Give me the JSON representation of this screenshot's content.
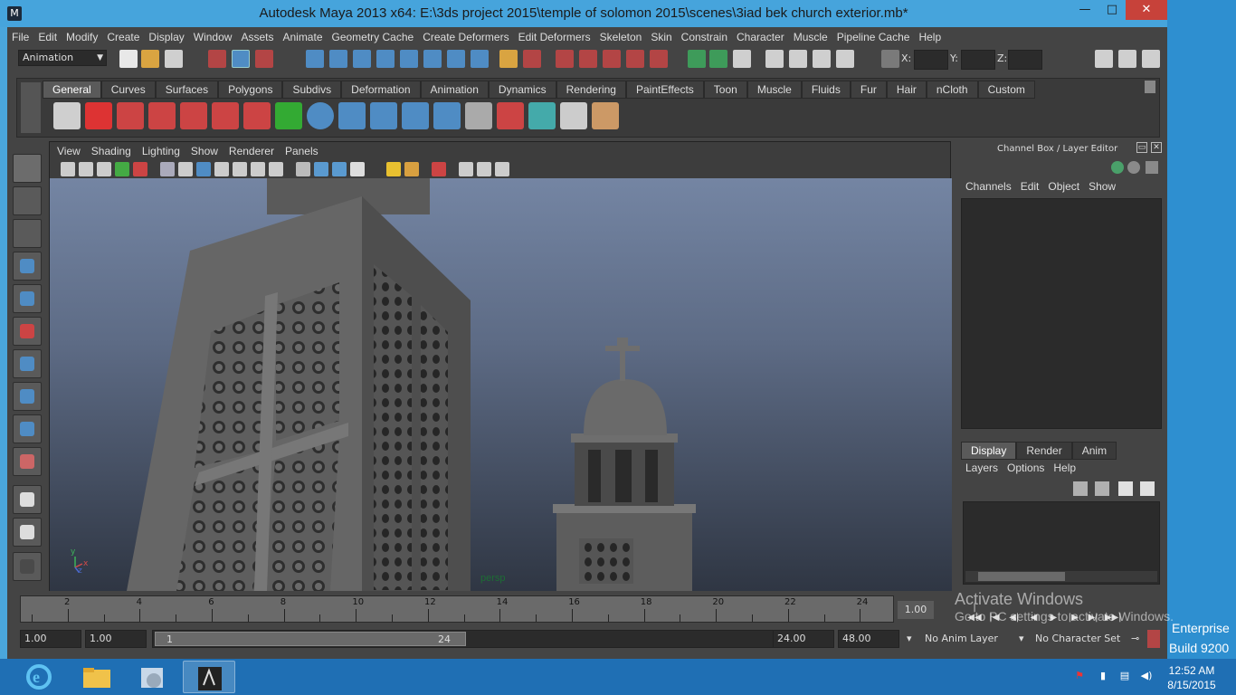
{
  "window": {
    "title": "Autodesk Maya 2013 x64: E:\\3ds project 2015\\temple of solomon 2015\\scenes\\3iad bek church exterior.mb*",
    "minimize": "—",
    "maximize": "□",
    "close": "✕"
  },
  "menubar": [
    "File",
    "Edit",
    "Modify",
    "Create",
    "Display",
    "Window",
    "Assets",
    "Animate",
    "Geometry Cache",
    "Create Deformers",
    "Edit Deformers",
    "Skeleton",
    "Skin",
    "Constrain",
    "Character",
    "Muscle",
    "Pipeline Cache",
    "Help"
  ],
  "statusline": {
    "mode": "Animation",
    "x_label": "X:",
    "y_label": "Y:",
    "z_label": "Z:"
  },
  "shelf": {
    "tabs": [
      "General",
      "Curves",
      "Surfaces",
      "Polygons",
      "Subdivs",
      "Deformation",
      "Animation",
      "Dynamics",
      "Rendering",
      "PaintEffects",
      "Toon",
      "Muscle",
      "Fluids",
      "Fur",
      "Hair",
      "nCloth",
      "Custom"
    ],
    "active_tab": "General",
    "icons": [
      "clapper-icon",
      "help-question-icon",
      "tool-clapper-icon",
      "move-clapper-icon",
      "rotate-clapper-icon",
      "scale-clapper-icon",
      "red-arrow-icon",
      "green-arrow-icon",
      "sphere-icon",
      "joint-icon",
      "joint-chain-icon",
      "ik-icon",
      "ik-chain-icon",
      "hypergraph-icon",
      "cube-red-icon",
      "cube-teal-icon",
      "cube-grid-icon",
      "paint-brush-icon"
    ]
  },
  "toolbox": [
    "select-tool-icon",
    "lasso-tool-icon",
    "paint-select-icon",
    "move-tool-icon",
    "rotate-tool-icon",
    "scale-tool-icon",
    "universal-manip-icon",
    "soft-mod-icon",
    "show-manip-icon",
    "last-tool-icon",
    "single-view-icon",
    "four-view-icon",
    "outliner-icon"
  ],
  "viewport": {
    "menu": [
      "View",
      "Shading",
      "Lighting",
      "Show",
      "Renderer",
      "Panels"
    ],
    "camera_label": "persp",
    "axis": {
      "y": "y",
      "x": "x",
      "z": "z"
    }
  },
  "channelbox": {
    "title": "Channel Box / Layer Editor",
    "menu": [
      "Channels",
      "Edit",
      "Object",
      "Show"
    ]
  },
  "layereditor": {
    "tabs": [
      "Display",
      "Render",
      "Anim"
    ],
    "active_tab": "Display",
    "menu": [
      "Layers",
      "Options",
      "Help"
    ]
  },
  "timeslider": {
    "ticks": [
      "2",
      "4",
      "6",
      "8",
      "10",
      "12",
      "14",
      "16",
      "18",
      "20",
      "22",
      "24"
    ],
    "current_frame": "1.00"
  },
  "range": {
    "start_time": "1.00",
    "playback_start": "1.00",
    "slider_start": "1",
    "slider_end": "24",
    "playback_end": "24.00",
    "end_time": "48.00",
    "anim_layer": "No Anim Layer",
    "character_set": "No Character Set"
  },
  "watermark": {
    "line1": "Activate Windows",
    "line2": "Go to PC settings to activate Windows."
  },
  "os": {
    "edition": "Enterprise",
    "build": "Build 9200",
    "time": "12:52 AM",
    "date": "8/15/2015"
  },
  "taskbar": [
    "internet-explorer-icon",
    "file-explorer-icon",
    "media-center-icon",
    "maya-icon"
  ]
}
